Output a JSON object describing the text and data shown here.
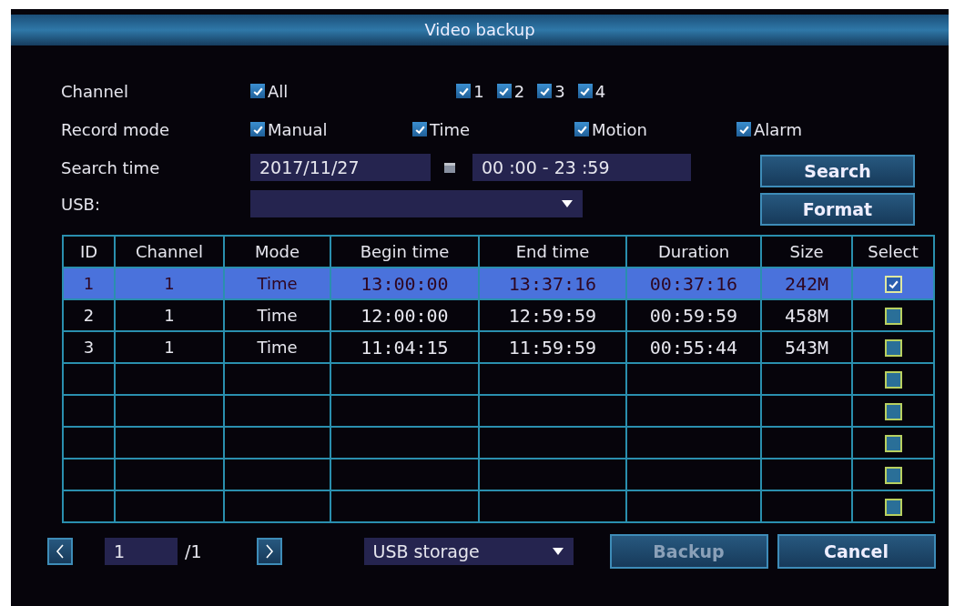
{
  "window": {
    "title": "Video backup"
  },
  "filters": {
    "channel_label": "Channel",
    "channel_all": {
      "label": "All",
      "checked": true
    },
    "channels": [
      {
        "label": "1",
        "checked": true
      },
      {
        "label": "2",
        "checked": true
      },
      {
        "label": "3",
        "checked": true
      },
      {
        "label": "4",
        "checked": true
      }
    ],
    "record_mode_label": "Record mode",
    "modes": [
      {
        "label": "Manual",
        "checked": true
      },
      {
        "label": "Time",
        "checked": true
      },
      {
        "label": "Motion",
        "checked": true
      },
      {
        "label": "Alarm",
        "checked": true
      }
    ],
    "search_time_label": "Search time",
    "date": "2017/11/27",
    "time_range": "00 :00 - 23 :59",
    "usb_label": "USB:"
  },
  "side_buttons": [
    {
      "label": "Search"
    },
    {
      "label": "Format"
    }
  ],
  "table": {
    "columns": [
      "ID",
      "Channel",
      "Mode",
      "Begin time",
      "End time",
      "Duration",
      "Size",
      "Select"
    ],
    "rows": [
      {
        "cells": [
          "1",
          "1",
          "Time",
          "13:00:00",
          "13:37:16",
          "00:37:16",
          "242M"
        ],
        "selected": true,
        "checked": true
      },
      {
        "cells": [
          "2",
          "1",
          "Time",
          "12:00:00",
          "12:59:59",
          "00:59:59",
          "458M"
        ],
        "selected": false,
        "checked": false
      },
      {
        "cells": [
          "3",
          "1",
          "Time",
          "11:04:15",
          "11:59:59",
          "00:55:44",
          "543M"
        ],
        "selected": false,
        "checked": false
      },
      {
        "selected": false,
        "checked": false
      },
      {
        "selected": false,
        "checked": false
      },
      {
        "selected": false,
        "checked": false
      },
      {
        "selected": false,
        "checked": false
      },
      {
        "selected": false,
        "checked": false
      }
    ]
  },
  "pager": {
    "page": "1",
    "total": "/1"
  },
  "storage": "USB storage",
  "actions": [
    {
      "label": "Backup",
      "disabled": true
    },
    {
      "label": "Cancel",
      "disabled": false
    }
  ]
}
